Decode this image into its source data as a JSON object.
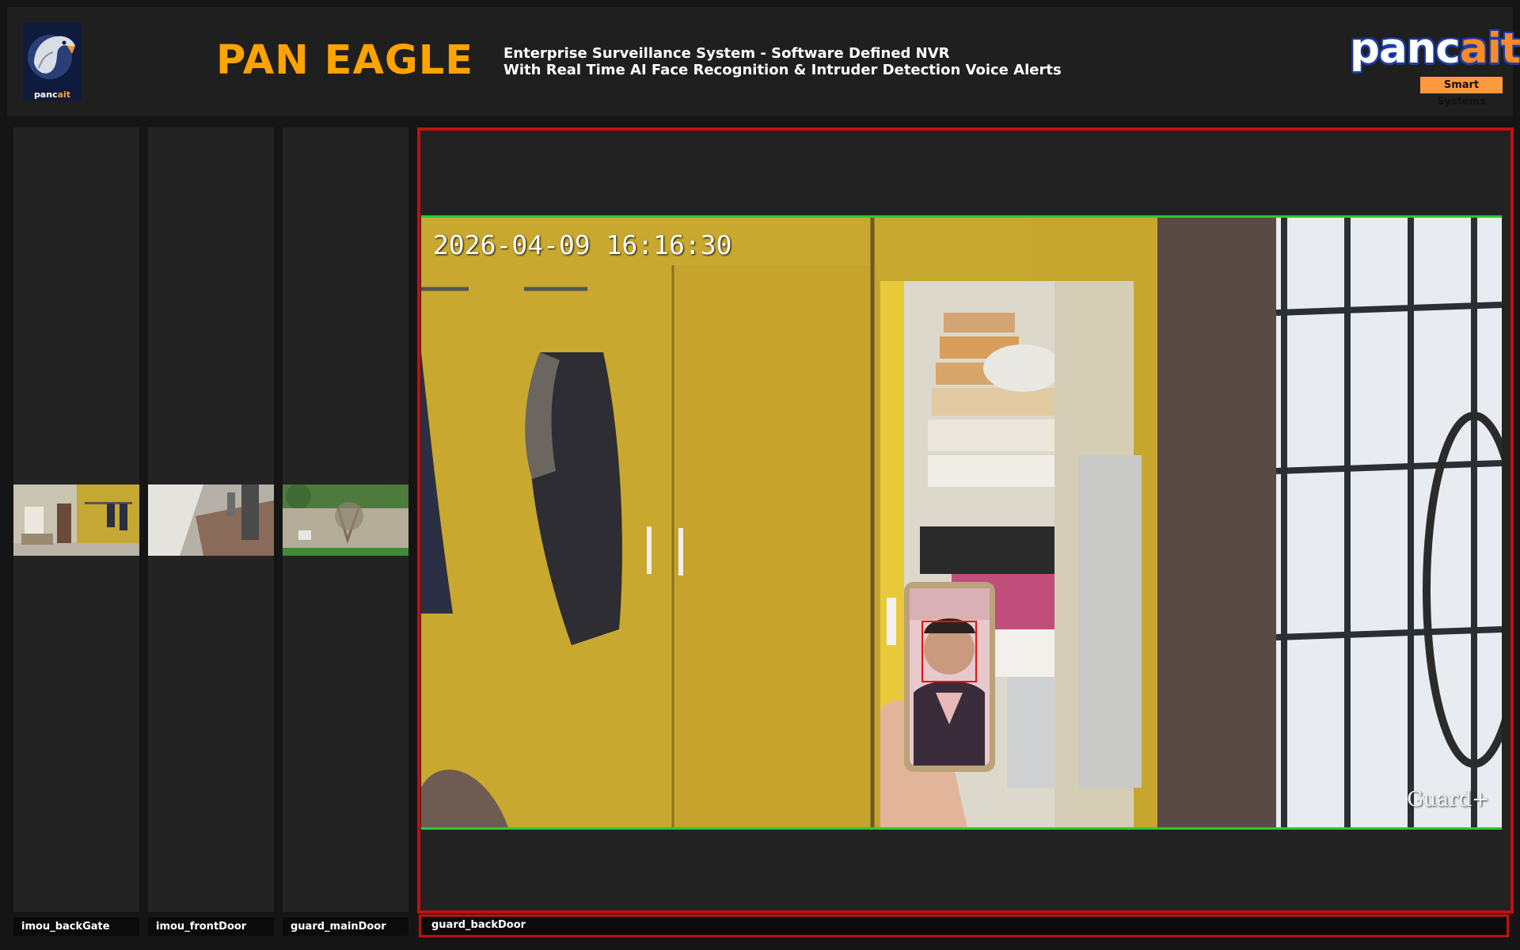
{
  "app": {
    "title": "PAN EAGLE",
    "subtitle_line1": "Enterprise Surveillance System - Software Defined NVR",
    "subtitle_line2": "With Real Time AI Face Recognition & Intruder Detection Voice Alerts",
    "logo_caption": {
      "a": "panc",
      "b": "ait"
    },
    "brand": {
      "word_a": "panc",
      "word_b": "ait",
      "tagline": "Smart Systems"
    }
  },
  "colors": {
    "accent": "#ffa300",
    "selected_border": "#c20f0f",
    "detection_border": "#1fcf35",
    "background": "#151515",
    "panel": "#232323"
  },
  "cameras": [
    {
      "name": "imou_backGate"
    },
    {
      "name": "imou_frontDoor"
    },
    {
      "name": "guard_mainDoor"
    }
  ],
  "main_view": {
    "camera_name": "guard_backDoor",
    "timestamp": "2026-04-09 16:16:30",
    "watermark": "Guard+",
    "icons": [
      "eagle-logo-icon",
      "face-detection-box"
    ]
  }
}
